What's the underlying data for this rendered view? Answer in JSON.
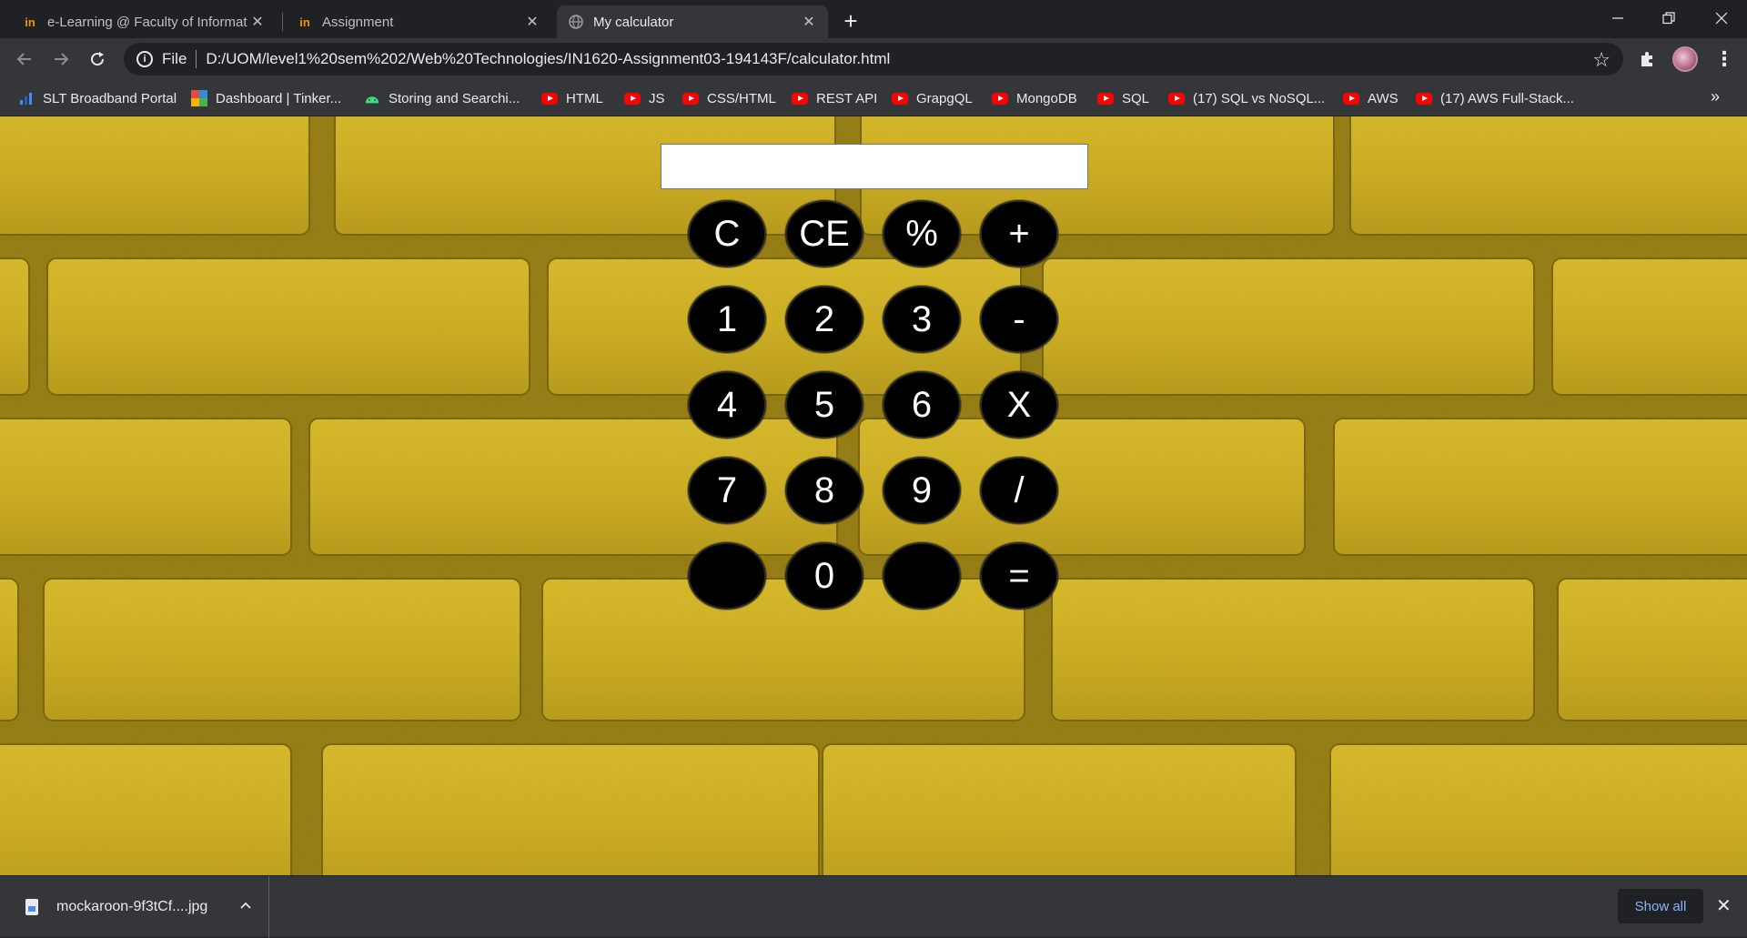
{
  "browser": {
    "tabs": [
      {
        "title": "e-Learning @ Faculty of Informat",
        "favicon": "in-logo-icon",
        "active": false
      },
      {
        "title": "Assignment",
        "favicon": "in-logo-icon",
        "active": false
      },
      {
        "title": "My calculator",
        "favicon": "globe-icon",
        "active": true
      }
    ],
    "new_tab_label": "+",
    "omnibox": {
      "scheme": "File",
      "url": "D:/UOM/level1%20sem%202/Web%20Technologies/IN1620-Assignment03-194143F/calculator.html"
    },
    "bookmarks": [
      {
        "label": "SLT Broadband Portal",
        "icon": "slt-icon"
      },
      {
        "label": "Dashboard | Tinker...",
        "icon": "tinkercad-icon"
      },
      {
        "label": "Storing and Searchi...",
        "icon": "android-icon"
      },
      {
        "label": "HTML",
        "icon": "youtube-icon"
      },
      {
        "label": "JS",
        "icon": "youtube-icon"
      },
      {
        "label": "CSS/HTML",
        "icon": "youtube-icon"
      },
      {
        "label": "REST API",
        "icon": "youtube-icon"
      },
      {
        "label": "GrapgQL",
        "icon": "youtube-icon"
      },
      {
        "label": "MongoDB",
        "icon": "youtube-icon"
      },
      {
        "label": "SQL",
        "icon": "youtube-icon"
      },
      {
        "label": "(17) SQL vs NoSQL...",
        "icon": "youtube-icon"
      },
      {
        "label": "AWS",
        "icon": "youtube-icon"
      },
      {
        "label": "(17) AWS Full-Stack...",
        "icon": "youtube-icon"
      }
    ],
    "bookmarks_more": "»"
  },
  "calculator": {
    "display_value": "",
    "keys": [
      [
        "C",
        "CE",
        "%",
        "+"
      ],
      [
        "1",
        "2",
        "3",
        "-"
      ],
      [
        "4",
        "5",
        "6",
        "X"
      ],
      [
        "7",
        "8",
        "9",
        "/"
      ],
      [
        "",
        "0",
        "",
        "="
      ]
    ]
  },
  "downloads": {
    "file_name": "mockaroon-9f3tCf....jpg",
    "show_all_label": "Show all"
  },
  "colors": {
    "page_background": "#c9a81a",
    "key_background": "#000000",
    "key_text": "#ffffff"
  }
}
